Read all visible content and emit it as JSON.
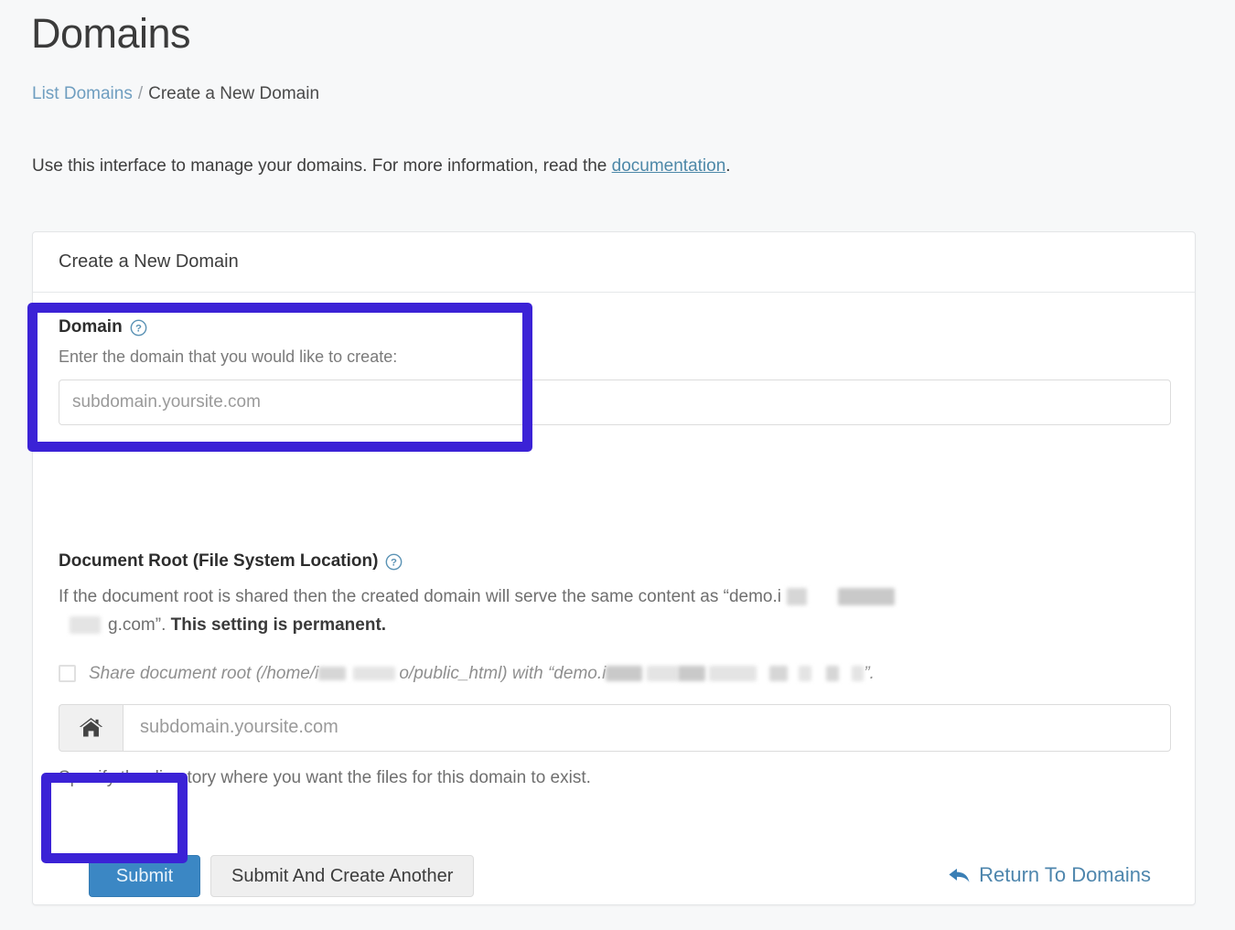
{
  "page": {
    "title": "Domains"
  },
  "breadcrumb": {
    "link_label": "List Domains",
    "separator": "/",
    "current_label": "Create a New Domain"
  },
  "intro": {
    "text_before": "Use this interface to manage your domains. For more information, read the ",
    "link_label": "documentation",
    "text_after": "."
  },
  "card": {
    "header_title": "Create a New Domain",
    "domain_field": {
      "label": "Domain",
      "help_icon": "question-circle-icon",
      "help_text": "Enter the domain that you would like to create:",
      "input_placeholder": "subdomain.yoursite.com",
      "input_value": ""
    },
    "document_root_field": {
      "label": "Document Root (File System Location)",
      "help_icon": "question-circle-icon",
      "description_part_1": "If the document root is shared then the created domain will serve the same content as “demo.i",
      "description_part_2": "g.com”. ",
      "description_bold": "This setting is permanent.",
      "share_checkbox_checked": false,
      "share_label_part_1": "Share document root (/home/i",
      "share_label_part_2": "o/public_html) with “demo.i",
      "share_label_part_3": "”.",
      "addon_icon": "home-icon",
      "input_placeholder": "subdomain.yoursite.com",
      "input_value": "",
      "hint": "Specify the directory where you want the files for this domain to exist."
    },
    "actions": {
      "submit_label": "Submit",
      "submit_and_create_another_label": "Submit And Create Another",
      "return_link_label": "Return To Domains",
      "return_icon": "arrow-back-icon"
    }
  },
  "annotations": {
    "highlight_color": "#3b22d6",
    "domain_group_highlight": "Domain field highlighted",
    "submit_button_highlight": "Submit button highlighted"
  },
  "colors": {
    "page_background": "#f7f8f9",
    "card_background": "#ffffff",
    "link": "#4d88a8",
    "breadcrumb_link": "#6f9ec0",
    "primary_button": "#3b87c4",
    "highlight": "#3b22d6"
  }
}
